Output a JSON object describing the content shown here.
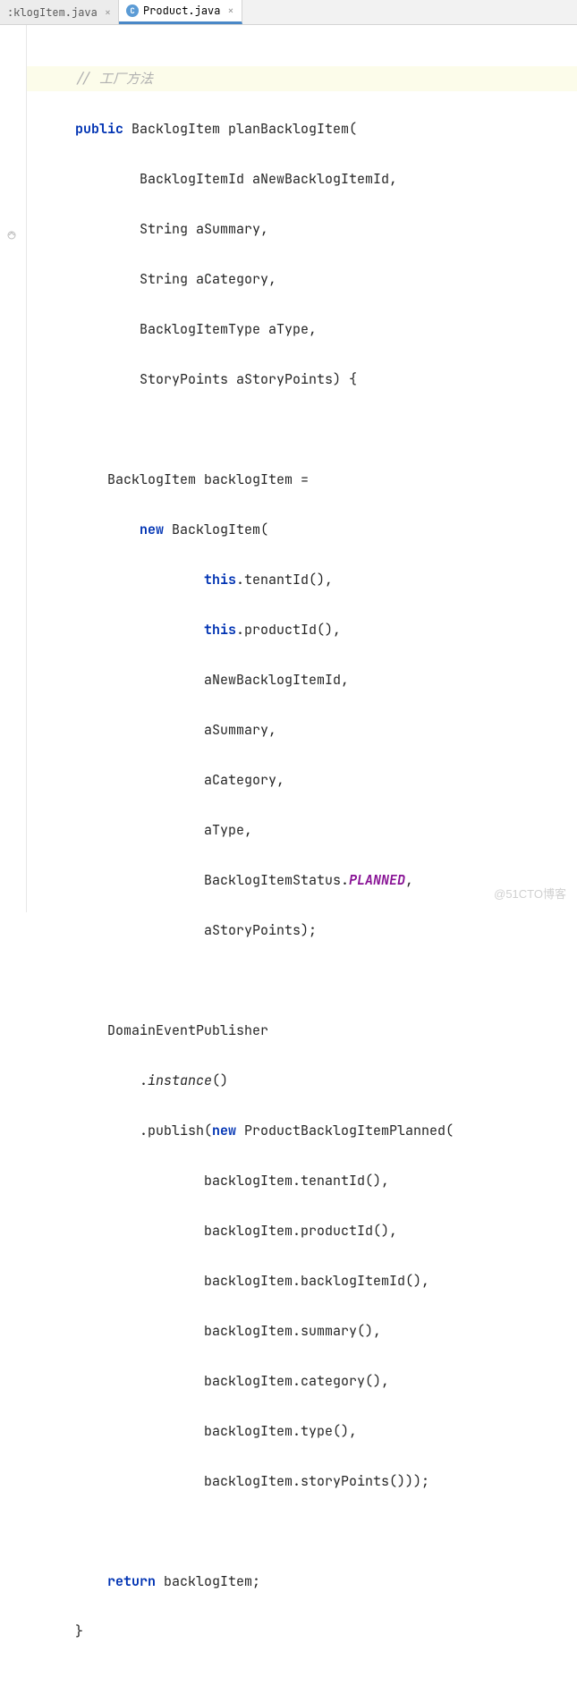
{
  "tabs": [
    {
      "label": ":klogItem.java",
      "active": false
    },
    {
      "label": "Product.java",
      "active": true,
      "icon_letter": "C"
    }
  ],
  "code": {
    "comment": "// 工厂方法",
    "l1_public": "public",
    "l1_rest": " BacklogItem planBacklogItem(",
    "l2": "BacklogItemId aNewBacklogItemId,",
    "l3": "String aSummary,",
    "l4": "String aCategory,",
    "l5": "BacklogItemType aType,",
    "l6": "StoryPoints aStoryPoints) {",
    "l7": "BacklogItem backlogItem =",
    "l8_new": "new",
    "l8_rest": " BacklogItem(",
    "l9_this": "this",
    "l9_rest": ".tenantId(),",
    "l10_this": "this",
    "l10_rest": ".productId(),",
    "l11": "aNewBacklogItemId,",
    "l12": "aSummary,",
    "l13": "aCategory,",
    "l14": "aType,",
    "l15_a": "BacklogItemStatus.",
    "l15_b": "PLANNED",
    "l15_c": ",",
    "l16": "aStoryPoints);",
    "l17": "DomainEventPublisher",
    "l18": ".instance()",
    "l18_a": ".",
    "l18_b": "instance",
    "l18_c": "()",
    "l19_a": ".publish(",
    "l19_new": "new",
    "l19_b": " ProductBacklogItemPlanned(",
    "l20": "backlogItem.tenantId(),",
    "l21": "backlogItem.productId(),",
    "l22": "backlogItem.backlogItemId(),",
    "l23": "backlogItem.summary(),",
    "l24": "backlogItem.category(),",
    "l25": "backlogItem.type(),",
    "l26": "backlogItem.storyPoints()));",
    "l27_return": "return",
    "l27_rest": " backlogItem;",
    "l28": "}"
  },
  "watermark": "@51CTO博客"
}
